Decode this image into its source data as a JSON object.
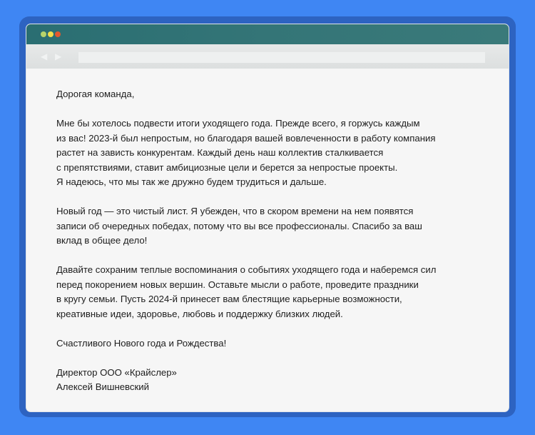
{
  "colors": {
    "background": "#3f86f3",
    "frame": "#2d63c1",
    "titlebar": "#2f7174"
  },
  "window": {
    "controls": [
      "close",
      "minimize",
      "zoom"
    ],
    "nav": {
      "back": "back-arrow-icon",
      "forward": "forward-arrow-icon"
    },
    "address": ""
  },
  "letter": {
    "greeting": "Дорогая команда,",
    "p1": [
      "Мне бы хотелось подвести итоги уходящего года. Прежде всего, я горжусь каждым",
      "из вас! 2023-й был непростым, но благодаря вашей вовлеченности в работу компания",
      "растет на зависть конкурентам. Каждый день наш коллектив сталкивается",
      "с препятствиями, ставит амбициозные цели и берется за непростые проекты.",
      "Я надеюсь, что мы так же дружно будем трудиться и дальше."
    ],
    "p2": [
      "Новый год — это чистый лист. Я убежден, что в скором времени на нем появятся",
      "записи об очередных победах, потому что вы все профессионалы. Спасибо за ваш",
      "вклад в общее дело!"
    ],
    "p3": [
      "Давайте сохраним теплые воспоминания о событиях уходящего года и наберемся сил",
      "перед покорением новых вершин. Оставьте мысли о работе, проведите праздники",
      "в кругу семьи. Пусть 2024-й принесет вам блестящие карьерные возможности,",
      "креативные идеи, здоровье, любовь и поддержку близких людей."
    ],
    "wish": "Счастливого Нового года и Рождества!",
    "signature": [
      "Директор ООО «Крайслер»",
      "Алексей Вишневский"
    ]
  }
}
